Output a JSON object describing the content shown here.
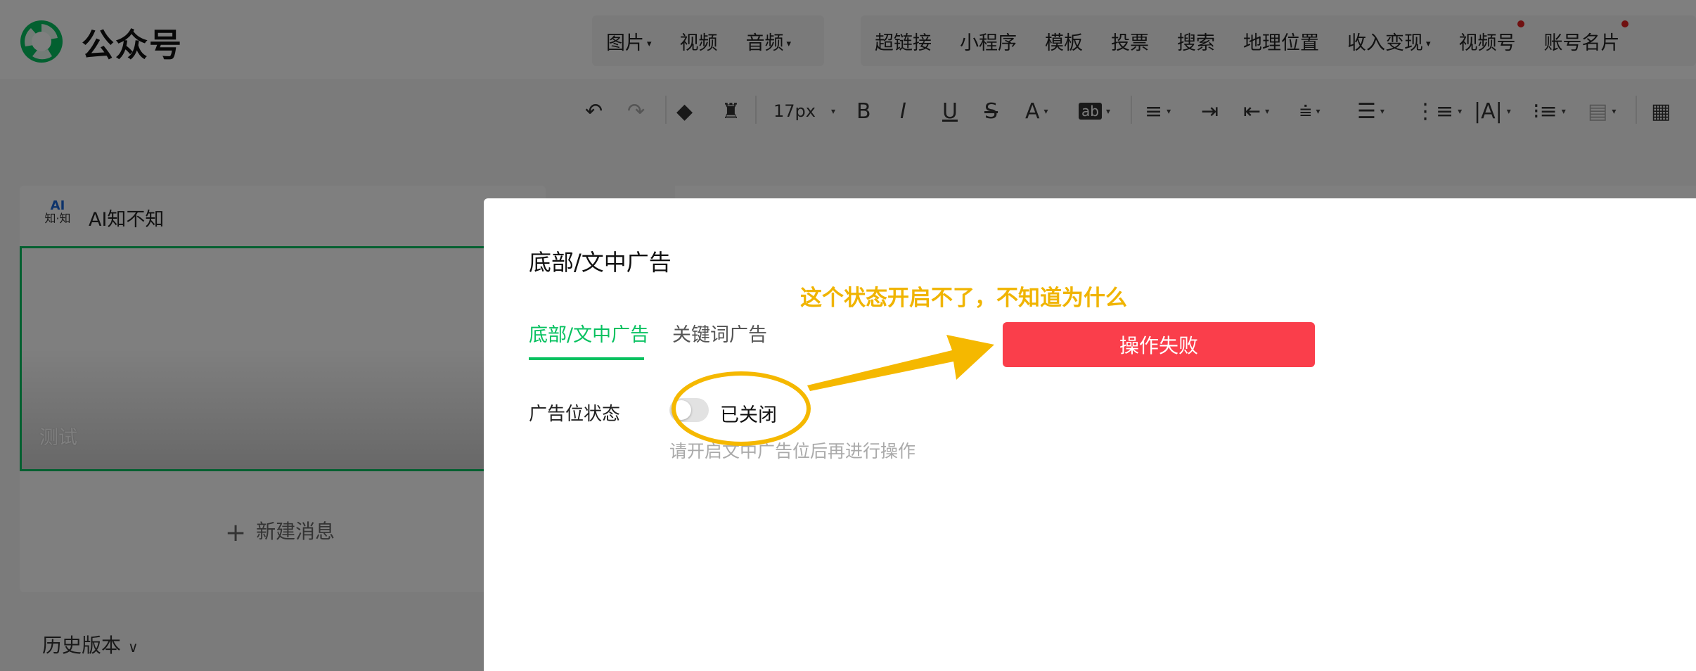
{
  "header": {
    "app_title": "公众号",
    "insert_group_a": [
      "图片",
      "视频",
      "音频"
    ],
    "insert_group_b": [
      "超链接",
      "小程序",
      "模板",
      "投票",
      "搜索",
      "地理位置",
      "收入变现",
      "视频号",
      "账号名片"
    ]
  },
  "toolbar": {
    "font_size": "17px",
    "icons": [
      "undo-icon",
      "redo-icon",
      "eraser-icon",
      "format-brush-icon",
      "bold-icon",
      "italic-icon",
      "underline-icon",
      "strikethrough-icon",
      "font-color-icon",
      "highlight-icon",
      "align-icon",
      "indent-icon",
      "line-height-icon",
      "list-icon",
      "table-icon"
    ]
  },
  "sidebar": {
    "ai_badge_top": "AI",
    "ai_badge_bottom": "知·知",
    "ai_title": "AI知不知",
    "article_label": "测试",
    "new_message": "新建消息",
    "history": "历史版本"
  },
  "dialog": {
    "title": "底部/文中广告",
    "tabs": [
      "底部/文中广告",
      "关键词广告"
    ],
    "status_label": "广告位状态",
    "switch_state": "已关闭",
    "switch_on": false,
    "hint": "请开启文中广告位后再进行操作"
  },
  "toast": {
    "message": "操作失败"
  },
  "annotation": {
    "note": "这个状态开启不了，不知道为什么",
    "color": "#f5b800"
  },
  "colors": {
    "brand_green": "#07c160",
    "error_red": "#fa3e4b"
  }
}
